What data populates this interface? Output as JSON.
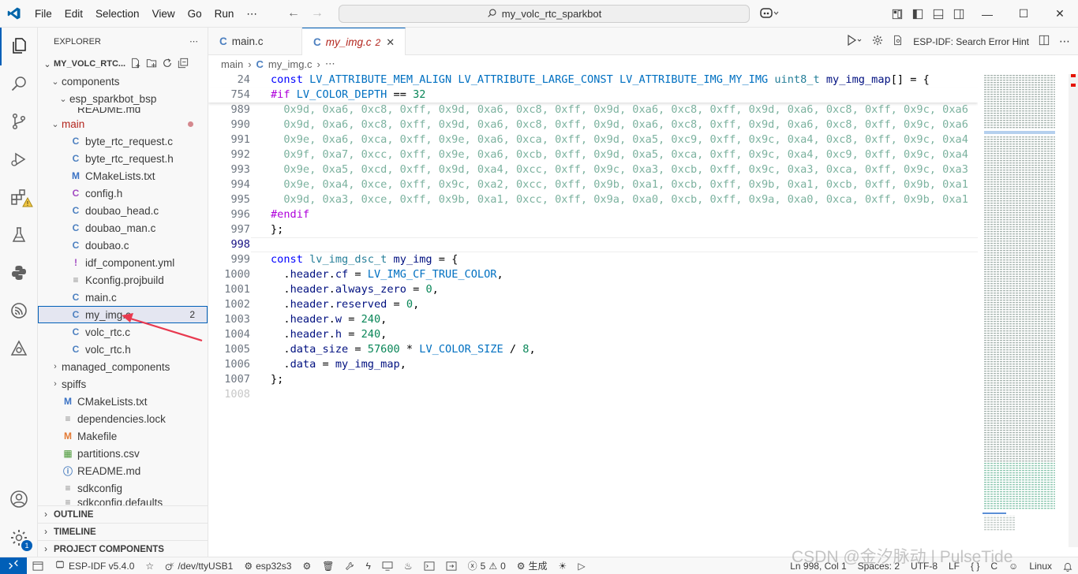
{
  "titlebar": {
    "menus": [
      "File",
      "Edit",
      "Selection",
      "View",
      "Go",
      "Run",
      "⋯"
    ],
    "search_text": "my_volc_rtc_sparkbot"
  },
  "activity_badges": {
    "extensions": "⚠",
    "settings": "1"
  },
  "explorer": {
    "title": "EXPLORER",
    "project": "MY_VOLC_RTC...",
    "rows": [
      {
        "label": "components",
        "indent": 1,
        "chev": "⌄",
        "icon": "",
        "icls": ""
      },
      {
        "label": "esp_sparkbot_bsp",
        "indent": 2,
        "chev": "⌄",
        "icon": "",
        "icls": ""
      },
      {
        "label": "README.md",
        "indent": 3,
        "chev": "",
        "icon": "",
        "icls": "",
        "partial": true
      },
      {
        "label": "main",
        "indent": 1,
        "chev": "⌄",
        "icon": "",
        "icls": "",
        "red": true,
        "dot": true
      },
      {
        "label": "byte_rtc_request.c",
        "indent": 2,
        "chev": "",
        "icon": "C",
        "icls": "ic-c"
      },
      {
        "label": "byte_rtc_request.h",
        "indent": 2,
        "chev": "",
        "icon": "C",
        "icls": "ic-c"
      },
      {
        "label": "CMakeLists.txt",
        "indent": 2,
        "chev": "",
        "icon": "M",
        "icls": "ic-m"
      },
      {
        "label": "config.h",
        "indent": 2,
        "chev": "",
        "icon": "C",
        "icls": "ic-y"
      },
      {
        "label": "doubao_head.c",
        "indent": 2,
        "chev": "",
        "icon": "C",
        "icls": "ic-c"
      },
      {
        "label": "doubao_man.c",
        "indent": 2,
        "chev": "",
        "icon": "C",
        "icls": "ic-c"
      },
      {
        "label": "doubao.c",
        "indent": 2,
        "chev": "",
        "icon": "C",
        "icls": "ic-c"
      },
      {
        "label": "idf_component.yml",
        "indent": 2,
        "chev": "",
        "icon": "!",
        "icls": "ic-y"
      },
      {
        "label": "Kconfig.projbuild",
        "indent": 2,
        "chev": "",
        "icon": "≡",
        "icls": "ic-txt"
      },
      {
        "label": "main.c",
        "indent": 2,
        "chev": "",
        "icon": "C",
        "icls": "ic-c"
      },
      {
        "label": "my_img.c",
        "indent": 2,
        "chev": "",
        "icon": "C",
        "icls": "ic-c",
        "selected": true,
        "count": "2"
      },
      {
        "label": "volc_rtc.c",
        "indent": 2,
        "chev": "",
        "icon": "C",
        "icls": "ic-c"
      },
      {
        "label": "volc_rtc.h",
        "indent": 2,
        "chev": "",
        "icon": "C",
        "icls": "ic-c"
      },
      {
        "label": "managed_components",
        "indent": 1,
        "chev": "›",
        "icon": "",
        "icls": ""
      },
      {
        "label": "spiffs",
        "indent": 1,
        "chev": "›",
        "icon": "",
        "icls": ""
      },
      {
        "label": "CMakeLists.txt",
        "indent": 1,
        "chev": "",
        "icon": "M",
        "icls": "ic-m"
      },
      {
        "label": "dependencies.lock",
        "indent": 1,
        "chev": "",
        "icon": "≡",
        "icls": "ic-txt"
      },
      {
        "label": "Makefile",
        "indent": 1,
        "chev": "",
        "icon": "M",
        "icls": "ic-mk"
      },
      {
        "label": "partitions.csv",
        "indent": 1,
        "chev": "",
        "icon": "▦",
        "icls": "ic-csv"
      },
      {
        "label": "README.md",
        "indent": 1,
        "chev": "",
        "icon": "ⓘ",
        "icls": "ic-info"
      },
      {
        "label": "sdkconfig",
        "indent": 1,
        "chev": "",
        "icon": "≡",
        "icls": "ic-txt"
      },
      {
        "label": "sdkconfig.defaults",
        "indent": 1,
        "chev": "",
        "icon": "≡",
        "icls": "ic-txt",
        "partial": true
      }
    ],
    "sections": [
      "OUTLINE",
      "TIMELINE",
      "PROJECT COMPONENTS"
    ]
  },
  "tabs": [
    {
      "label": "main.c",
      "active": false
    },
    {
      "label": "my_img.c",
      "active": true,
      "problems": "2"
    }
  ],
  "tab_actions": {
    "search_hint": "ESP-IDF: Search Error Hint"
  },
  "breadcrumb": {
    "folder": "main",
    "file": "my_img.c",
    "more": "⋯"
  },
  "editor": {
    "lines": [
      {
        "n": "24",
        "sticky": true,
        "t": [
          [
            "kw",
            "const "
          ],
          [
            "mac",
            "LV_ATTRIBUTE_MEM_ALIGN LV_ATTRIBUTE_LARGE_CONST LV_ATTRIBUTE_IMG_MY_IMG "
          ],
          [
            "ty",
            "uint8_t "
          ],
          [
            "id",
            "my_img_map"
          ],
          [
            "pl",
            "[] = {"
          ]
        ]
      },
      {
        "n": "754",
        "sticky": true,
        "t": [
          [
            "pp",
            "#if "
          ],
          [
            "mac",
            "LV_COLOR_DEPTH"
          ],
          [
            "pl",
            " == "
          ],
          [
            "num",
            "32"
          ]
        ]
      },
      {
        "n": "989",
        "t": [
          [
            "hex",
            "  0x9d, 0xa6, 0xc8, 0xff, 0x9d, 0xa6, 0xc8, 0xff, 0x9d, 0xa6, 0xc8, 0xff, 0x9d, 0xa6, 0xc8, 0xff, 0x9c, 0xa6"
          ]
        ]
      },
      {
        "n": "990",
        "t": [
          [
            "hex",
            "  0x9d, 0xa6, 0xc8, 0xff, 0x9d, 0xa6, 0xc8, 0xff, 0x9d, 0xa6, 0xc8, 0xff, 0x9d, 0xa6, 0xc8, 0xff, 0x9c, 0xa6"
          ]
        ]
      },
      {
        "n": "991",
        "t": [
          [
            "hex",
            "  0x9e, 0xa6, 0xca, 0xff, 0x9e, 0xa6, 0xca, 0xff, 0x9d, 0xa5, 0xc9, 0xff, 0x9c, 0xa4, 0xc8, 0xff, 0x9c, 0xa4"
          ]
        ]
      },
      {
        "n": "992",
        "t": [
          [
            "hex",
            "  0x9f, 0xa7, 0xcc, 0xff, 0x9e, 0xa6, 0xcb, 0xff, 0x9d, 0xa5, 0xca, 0xff, 0x9c, 0xa4, 0xc9, 0xff, 0x9c, 0xa4"
          ]
        ]
      },
      {
        "n": "993",
        "t": [
          [
            "hex",
            "  0x9e, 0xa5, 0xcd, 0xff, 0x9d, 0xa4, 0xcc, 0xff, 0x9c, 0xa3, 0xcb, 0xff, 0x9c, 0xa3, 0xca, 0xff, 0x9c, 0xa3"
          ]
        ]
      },
      {
        "n": "994",
        "t": [
          [
            "hex",
            "  0x9e, 0xa4, 0xce, 0xff, 0x9c, 0xa2, 0xcc, 0xff, 0x9b, 0xa1, 0xcb, 0xff, 0x9b, 0xa1, 0xcb, 0xff, 0x9b, 0xa1"
          ]
        ]
      },
      {
        "n": "995",
        "t": [
          [
            "hex",
            "  0x9d, 0xa3, 0xce, 0xff, 0x9b, 0xa1, 0xcc, 0xff, 0x9a, 0xa0, 0xcb, 0xff, 0x9a, 0xa0, 0xca, 0xff, 0x9b, 0xa1"
          ]
        ]
      },
      {
        "n": "996",
        "t": [
          [
            "pp",
            "#endif"
          ]
        ]
      },
      {
        "n": "997",
        "t": [
          [
            "pl",
            "};"
          ]
        ]
      },
      {
        "n": "998",
        "cur": true,
        "t": [
          [
            "pl",
            ""
          ]
        ]
      },
      {
        "n": "999",
        "t": [
          [
            "kw",
            "const "
          ],
          [
            "ty",
            "lv_img_dsc_t "
          ],
          [
            "id",
            "my_img"
          ],
          [
            "pl",
            " = {"
          ]
        ]
      },
      {
        "n": "1000",
        "t": [
          [
            "pl",
            "  ."
          ],
          [
            "id",
            "header"
          ],
          [
            "pl",
            "."
          ],
          [
            "id",
            "cf"
          ],
          [
            "pl",
            " = "
          ],
          [
            "mac",
            "LV_IMG_CF_TRUE_COLOR"
          ],
          [
            "pl",
            ","
          ]
        ]
      },
      {
        "n": "1001",
        "t": [
          [
            "pl",
            "  ."
          ],
          [
            "id",
            "header"
          ],
          [
            "pl",
            "."
          ],
          [
            "id",
            "always_zero"
          ],
          [
            "pl",
            " = "
          ],
          [
            "num",
            "0"
          ],
          [
            "pl",
            ","
          ]
        ]
      },
      {
        "n": "1002",
        "t": [
          [
            "pl",
            "  ."
          ],
          [
            "id",
            "header"
          ],
          [
            "pl",
            "."
          ],
          [
            "id",
            "reserved"
          ],
          [
            "pl",
            " = "
          ],
          [
            "num",
            "0"
          ],
          [
            "pl",
            ","
          ]
        ]
      },
      {
        "n": "1003",
        "t": [
          [
            "pl",
            "  ."
          ],
          [
            "id",
            "header"
          ],
          [
            "pl",
            "."
          ],
          [
            "id",
            "w"
          ],
          [
            "pl",
            " = "
          ],
          [
            "num",
            "240"
          ],
          [
            "pl",
            ","
          ]
        ]
      },
      {
        "n": "1004",
        "t": [
          [
            "pl",
            "  ."
          ],
          [
            "id",
            "header"
          ],
          [
            "pl",
            "."
          ],
          [
            "id",
            "h"
          ],
          [
            "pl",
            " = "
          ],
          [
            "num",
            "240"
          ],
          [
            "pl",
            ","
          ]
        ]
      },
      {
        "n": "1005",
        "t": [
          [
            "pl",
            "  ."
          ],
          [
            "id",
            "data_size"
          ],
          [
            "pl",
            " = "
          ],
          [
            "num",
            "57600"
          ],
          [
            "pl",
            " * "
          ],
          [
            "mac",
            "LV_COLOR_SIZE"
          ],
          [
            "pl",
            " / "
          ],
          [
            "num",
            "8"
          ],
          [
            "pl",
            ","
          ]
        ]
      },
      {
        "n": "1006",
        "t": [
          [
            "pl",
            "  ."
          ],
          [
            "id",
            "data"
          ],
          [
            "pl",
            " = "
          ],
          [
            "id",
            "my_img_map"
          ],
          [
            "pl",
            ","
          ]
        ]
      },
      {
        "n": "1007",
        "t": [
          [
            "pl",
            "};"
          ]
        ]
      },
      {
        "n": "1008",
        "dim": true,
        "t": [
          [
            "pl",
            ""
          ]
        ]
      }
    ]
  },
  "statusbar": {
    "esp_idf": "ESP-IDF v5.4.0",
    "port": "/dev/ttyUSB1",
    "target": "esp32s3",
    "errors": "5",
    "warnings": "0",
    "build": "生成",
    "position": "Ln 998, Col 1",
    "spaces": "Spaces: 2",
    "encoding": "UTF-8",
    "eol": "LF",
    "braces": "{ }",
    "lang": "C",
    "os": "Linux"
  },
  "watermark": "CSDN @金汐脉动 | PulseTide"
}
